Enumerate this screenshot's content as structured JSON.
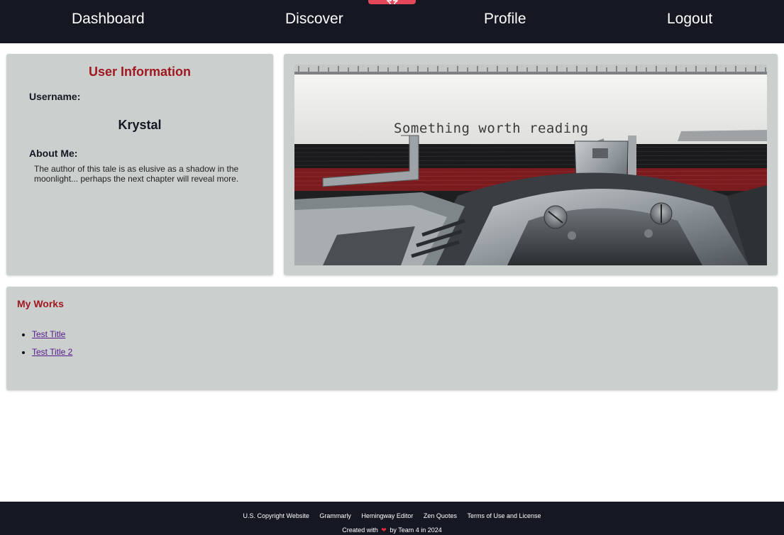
{
  "nav": {
    "items": [
      {
        "label": "Dashboard"
      },
      {
        "label": "Discover"
      },
      {
        "label": "Profile"
      },
      {
        "label": "Logout"
      }
    ],
    "badge_icon": "star-icon",
    "badge_color": "#e4475a"
  },
  "user_info": {
    "title": "User Information",
    "username_label": "Username:",
    "username": "Krystal",
    "about_label": "About Me:",
    "about_text": "The author of this tale is as elusive as a shadow in the moonlight... perhaps the next chapter will reveal more."
  },
  "hero": {
    "typed_text": "Something worth reading"
  },
  "works": {
    "title": "My Works",
    "items": [
      {
        "label": "Test Title"
      },
      {
        "label": "Test Title 2"
      }
    ]
  },
  "footer": {
    "links": [
      {
        "label": "U.S. Copyright Website"
      },
      {
        "label": "Grammarly"
      },
      {
        "label": "Hemingway Editor"
      },
      {
        "label": "Zen Quotes"
      },
      {
        "label": "Terms of Use and License"
      }
    ],
    "credit_prefix": "Created with",
    "credit_icon": "heart-icon",
    "credit_suffix": "by Team 4 in 2024"
  },
  "colors": {
    "nav_bg": "#151722",
    "card_bg": "#cbd0ce",
    "accent": "#a01820",
    "link": "#551a8b"
  }
}
